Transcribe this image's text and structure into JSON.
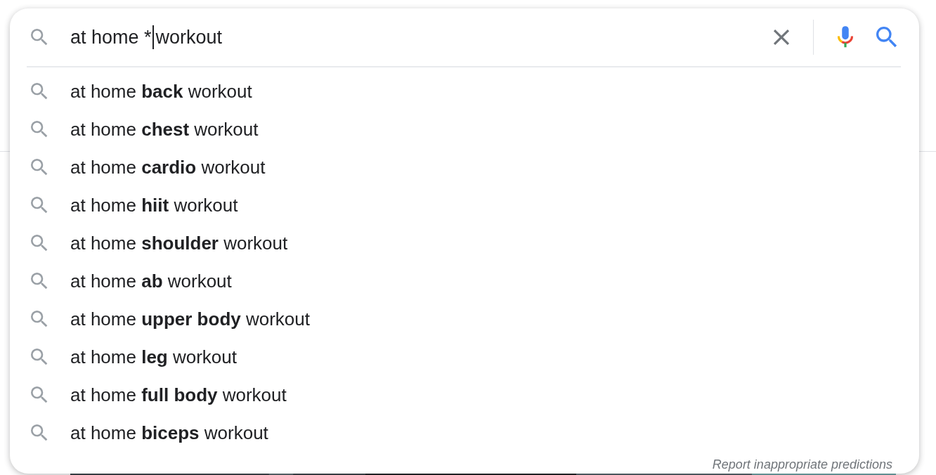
{
  "search": {
    "text_before_caret": "at home *",
    "text_after_caret": "workout"
  },
  "suggestions": [
    "at home **back** workout",
    "at home **chest** workout",
    "at home **cardio** workout",
    "at home **hiit** workout",
    "at home **shoulder** workout",
    "at home **ab** workout",
    "at home **upper body** workout",
    "at home **leg** workout",
    "at home **full body** workout",
    "at home **biceps** workout"
  ],
  "report_link": "Report inappropriate predictions"
}
